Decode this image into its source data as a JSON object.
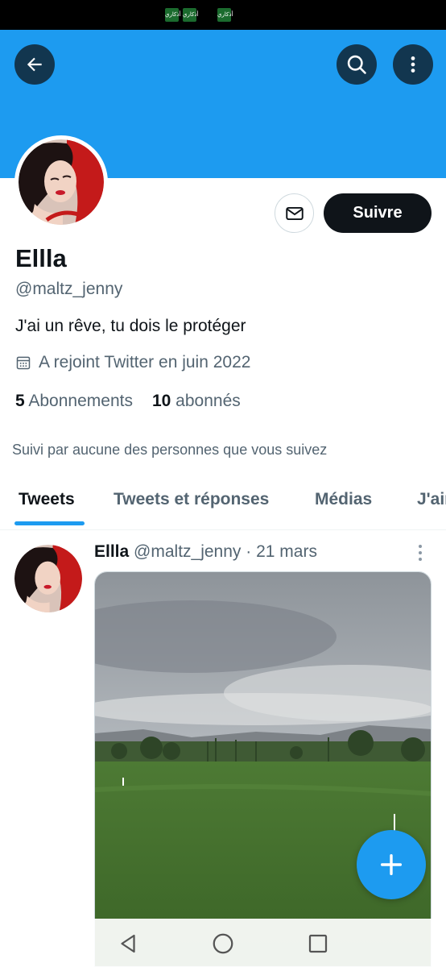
{
  "status_bar": {
    "notifications": [
      "أذكاري",
      "أذكاري",
      "أذكاري"
    ]
  },
  "header": {
    "back_icon": "arrow-left-icon",
    "search_icon": "search-icon",
    "more_icon": "more-vertical-icon",
    "banner_color": "#1d9bf0"
  },
  "profile": {
    "message_icon": "envelope-icon",
    "follow_label": "Suivre",
    "display_name": "Ellla",
    "handle": "@maltz_jenny",
    "bio": "J'ai un rêve, tu dois le protéger",
    "joined_icon": "calendar-icon",
    "joined": "A rejoint Twitter en juin 2022",
    "following_count": "5",
    "following_label": "Abonnements",
    "followers_count": "10",
    "followers_label": "abonnés",
    "followed_by": "Suivi par aucune des personnes que vous suivez"
  },
  "tabs": [
    {
      "label": "Tweets",
      "active": true
    },
    {
      "label": "Tweets et réponses",
      "active": false
    },
    {
      "label": "Médias",
      "active": false
    },
    {
      "label": "J'aime",
      "active": false
    }
  ],
  "tweet": {
    "name": "Ellla",
    "handle": "@maltz_jenny",
    "separator": "·",
    "date": "21 mars"
  },
  "fab_icon": "plus-icon",
  "android_nav": {
    "back": "triangle-back-icon",
    "home": "circle-home-icon",
    "recents": "square-recents-icon"
  },
  "colors": {
    "accent": "#1d9bf0",
    "text": "#0f1419",
    "secondary": "#536471"
  }
}
